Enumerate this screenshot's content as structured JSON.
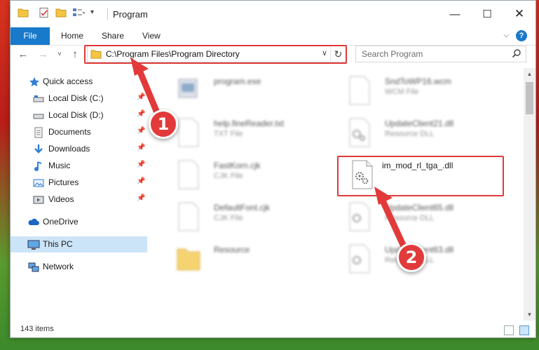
{
  "window": {
    "title": "Program"
  },
  "ribbon": {
    "tabs": [
      "File",
      "Home",
      "Share",
      "View"
    ]
  },
  "address_bar": {
    "path": "C:\\Program Files\\Program Directory"
  },
  "search": {
    "placeholder": "Search Program"
  },
  "nav": {
    "items": [
      {
        "label": "Quick access",
        "icon": "star-icon"
      },
      {
        "label": "Local Disk (C:)",
        "icon": "drive-icon",
        "pinned": true
      },
      {
        "label": "Local Disk (D:)",
        "icon": "drive-icon",
        "pinned": true
      },
      {
        "label": "Documents",
        "icon": "documents-icon",
        "pinned": true
      },
      {
        "label": "Downloads",
        "icon": "download-icon",
        "pinned": true
      },
      {
        "label": "Music",
        "icon": "music-icon",
        "pinned": true
      },
      {
        "label": "Pictures",
        "icon": "pictures-icon",
        "pinned": true
      },
      {
        "label": "Videos",
        "icon": "videos-icon",
        "pinned": true
      },
      {
        "label": "OneDrive",
        "icon": "cloud-icon"
      },
      {
        "label": "This PC",
        "icon": "computer-icon",
        "selected": true
      },
      {
        "label": "Network",
        "icon": "network-icon"
      }
    ]
  },
  "files": [
    {
      "name": "program.exe",
      "type": "",
      "icon": "exe-icon"
    },
    {
      "name": "SndToWP16.wcm",
      "type": "WCM File",
      "icon": "file-icon"
    },
    {
      "name": "help.fineReader.txt",
      "type": "TXT File",
      "icon": "file-icon"
    },
    {
      "name": "UpdateClient21.dll",
      "type": "Resource DLL",
      "icon": "dll-icon"
    },
    {
      "name": "FastKorn.cjk",
      "type": "CJK File",
      "icon": "file-icon"
    },
    {
      "name": "im_mod_rl_tga_.dll",
      "type": "",
      "icon": "dll-icon"
    },
    {
      "name": "DefaultFont.cjk",
      "type": "CJK File",
      "icon": "file-icon"
    },
    {
      "name": "UpdateClient65.dll",
      "type": "Resource DLL",
      "icon": "dll-icon"
    },
    {
      "name": "Resource",
      "type": "",
      "icon": "folder-icon"
    },
    {
      "name": "UpdateClient63.dll",
      "type": "Resource DLL",
      "icon": "dll-icon"
    }
  ],
  "status": {
    "item_count": "143 items"
  },
  "annotations": {
    "step1": "1",
    "step2": "2",
    "color": "#e03a3a"
  }
}
